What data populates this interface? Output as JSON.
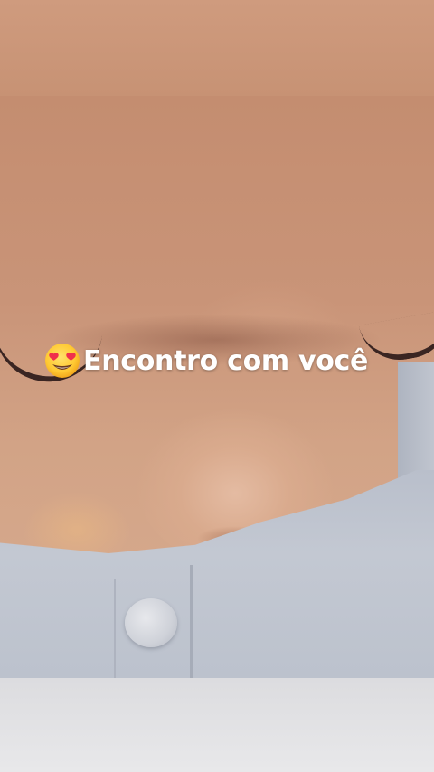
{
  "caption": {
    "emoji_icon": "smiling-face-with-heart-eyes-icon",
    "text": "Encontro com você"
  },
  "colors": {
    "skin": "#c99478",
    "shirt": "#c3c8d2",
    "caption_text": "#ffffff"
  }
}
